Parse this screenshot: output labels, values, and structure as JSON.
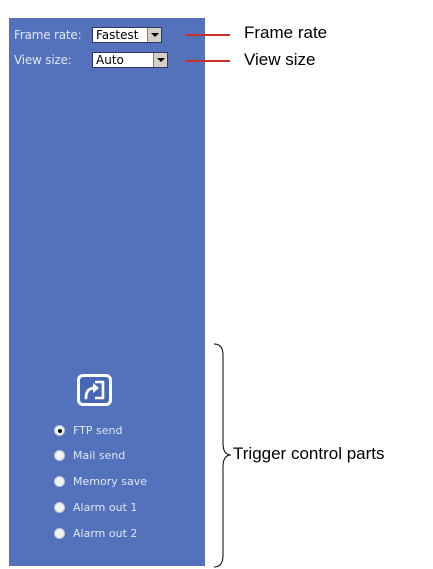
{
  "controls": {
    "frame_rate_label": "Frame rate:",
    "frame_rate_value": "Fastest",
    "view_size_label": "View size:",
    "view_size_value": "Auto"
  },
  "callouts": {
    "frame_rate": "Frame rate",
    "view_size": "View size",
    "trigger": "Trigger control parts"
  },
  "trigger_button_icon": "share-arrow-icon",
  "triggers": [
    {
      "label": "FTP send",
      "checked": true
    },
    {
      "label": "Mail send",
      "checked": false
    },
    {
      "label": "Memory save",
      "checked": false
    },
    {
      "label": "Alarm out 1",
      "checked": false
    },
    {
      "label": "Alarm out 2",
      "checked": false
    }
  ],
  "colors": {
    "panel": "#5372bb",
    "leader_line": "#c8302c"
  }
}
